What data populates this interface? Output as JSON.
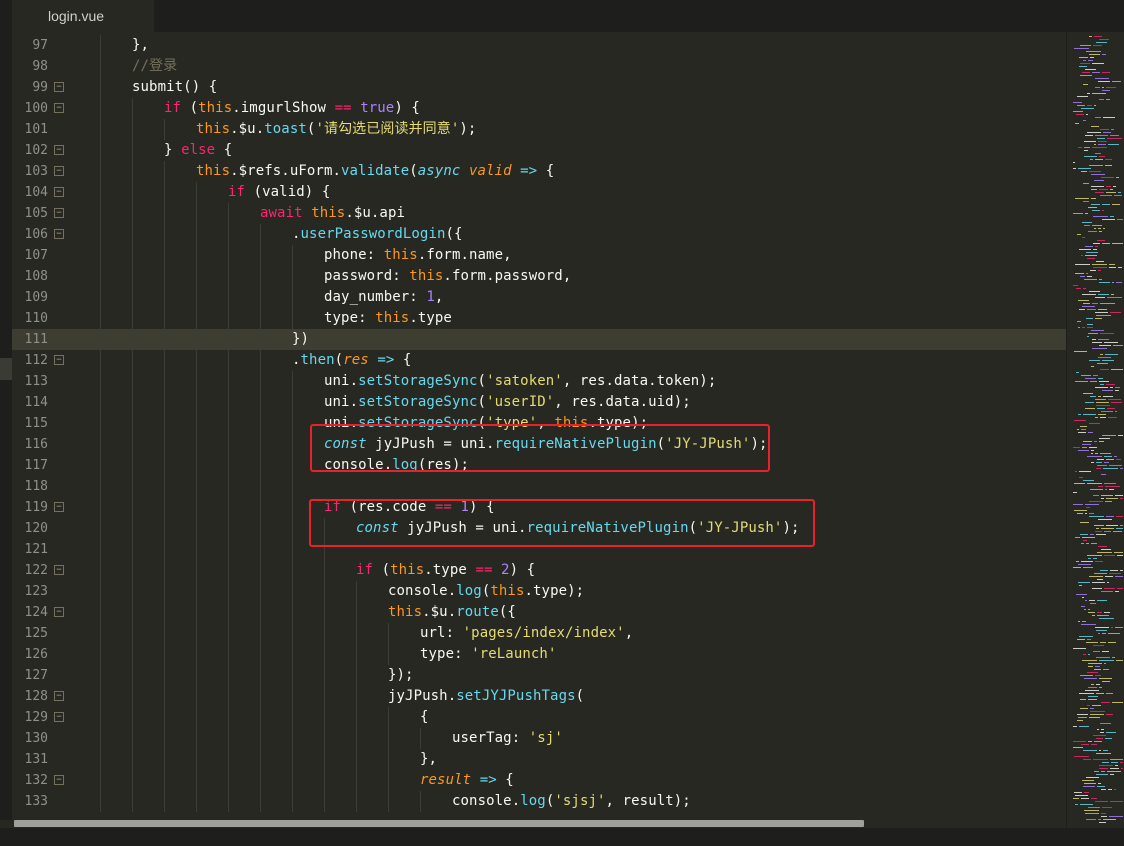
{
  "tab": {
    "filename": "login.vue"
  },
  "colors": {
    "background": "#272822",
    "keyword": "#f92672",
    "this": "#fd971f",
    "function": "#66d9ef",
    "string": "#e6db74",
    "number": "#ae81ff",
    "comment": "#75715e",
    "highlight_box": "#e8212b"
  },
  "current_line": "111",
  "lines": [
    {
      "ln": "97",
      "indent": 2,
      "fold": false,
      "tokens": [
        [
          "},",
          ""
        ]
      ]
    },
    {
      "ln": "98",
      "indent": 2,
      "fold": false,
      "tokens": [
        [
          "//登录",
          "c"
        ]
      ]
    },
    {
      "ln": "99",
      "indent": 2,
      "fold": true,
      "tokens": [
        [
          "submit() {",
          ""
        ]
      ]
    },
    {
      "ln": "100",
      "indent": 3,
      "fold": true,
      "tokens": [
        [
          "if",
          "k"
        ],
        [
          " (",
          ""
        ],
        [
          "this",
          "t"
        ],
        [
          ".imgurlShow ",
          ""
        ],
        [
          "==",
          "k"
        ],
        [
          " ",
          ""
        ],
        [
          "true",
          "n"
        ],
        [
          ") {",
          ""
        ]
      ]
    },
    {
      "ln": "101",
      "indent": 4,
      "fold": false,
      "tokens": [
        [
          "this",
          "t"
        ],
        [
          ".$u.",
          ""
        ],
        [
          "toast",
          "f"
        ],
        [
          "(",
          ""
        ],
        [
          "'请勾选已阅读并同意'",
          "s"
        ],
        [
          ");",
          ""
        ]
      ]
    },
    {
      "ln": "102",
      "indent": 3,
      "fold": true,
      "tokens": [
        [
          "} ",
          ""
        ],
        [
          "else",
          "k"
        ],
        [
          " {",
          ""
        ]
      ]
    },
    {
      "ln": "103",
      "indent": 4,
      "fold": true,
      "tokens": [
        [
          "this",
          "t"
        ],
        [
          ".$refs.uForm.",
          ""
        ],
        [
          "validate",
          "f"
        ],
        [
          "(",
          ""
        ],
        [
          "async",
          "fi"
        ],
        [
          " ",
          ""
        ],
        [
          "valid",
          "p"
        ],
        [
          " ",
          ""
        ],
        [
          "=>",
          "f"
        ],
        [
          " {",
          ""
        ]
      ]
    },
    {
      "ln": "104",
      "indent": 5,
      "fold": true,
      "tokens": [
        [
          "if",
          "k"
        ],
        [
          " (valid) {",
          ""
        ]
      ]
    },
    {
      "ln": "105",
      "indent": 6,
      "fold": true,
      "tokens": [
        [
          "await",
          "k"
        ],
        [
          " ",
          ""
        ],
        [
          "this",
          "t"
        ],
        [
          ".$u.api",
          ""
        ]
      ]
    },
    {
      "ln": "106",
      "indent": 7,
      "fold": true,
      "tokens": [
        [
          ".",
          ""
        ],
        [
          "userPasswordLogin",
          "f"
        ],
        [
          "({",
          ""
        ]
      ]
    },
    {
      "ln": "107",
      "indent": 8,
      "fold": false,
      "tokens": [
        [
          "phone: ",
          ""
        ],
        [
          "this",
          "t"
        ],
        [
          ".form.name,",
          ""
        ]
      ]
    },
    {
      "ln": "108",
      "indent": 8,
      "fold": false,
      "tokens": [
        [
          "password: ",
          ""
        ],
        [
          "this",
          "t"
        ],
        [
          ".form.password,",
          ""
        ]
      ]
    },
    {
      "ln": "109",
      "indent": 8,
      "fold": false,
      "tokens": [
        [
          "day_number: ",
          ""
        ],
        [
          "1",
          "n"
        ],
        [
          ",",
          ""
        ]
      ]
    },
    {
      "ln": "110",
      "indent": 8,
      "fold": false,
      "tokens": [
        [
          "type: ",
          ""
        ],
        [
          "this",
          "t"
        ],
        [
          ".type",
          ""
        ]
      ]
    },
    {
      "ln": "111",
      "indent": 7,
      "fold": false,
      "tokens": [
        [
          "})",
          ""
        ]
      ]
    },
    {
      "ln": "112",
      "indent": 7,
      "fold": true,
      "tokens": [
        [
          ".",
          ""
        ],
        [
          "then",
          "f"
        ],
        [
          "(",
          ""
        ],
        [
          "res",
          "p"
        ],
        [
          " ",
          ""
        ],
        [
          "=>",
          "f"
        ],
        [
          " {",
          ""
        ]
      ]
    },
    {
      "ln": "113",
      "indent": 8,
      "fold": false,
      "tokens": [
        [
          "uni.",
          ""
        ],
        [
          "setStorageSync",
          "f"
        ],
        [
          "(",
          ""
        ],
        [
          "'satoken'",
          "s"
        ],
        [
          ", res.data.token);",
          ""
        ]
      ]
    },
    {
      "ln": "114",
      "indent": 8,
      "fold": false,
      "tokens": [
        [
          "uni.",
          ""
        ],
        [
          "setStorageSync",
          "f"
        ],
        [
          "(",
          ""
        ],
        [
          "'userID'",
          "s"
        ],
        [
          ", res.data.uid);",
          ""
        ]
      ]
    },
    {
      "ln": "115",
      "indent": 8,
      "fold": false,
      "tokens": [
        [
          "uni.",
          ""
        ],
        [
          "setStorageSync",
          "f"
        ],
        [
          "(",
          ""
        ],
        [
          "'type'",
          "s"
        ],
        [
          ", ",
          ""
        ],
        [
          "this",
          "t"
        ],
        [
          ".type);",
          ""
        ]
      ]
    },
    {
      "ln": "116",
      "indent": 8,
      "fold": false,
      "tokens": [
        [
          "const",
          "fi"
        ],
        [
          " jyJPush = uni.",
          ""
        ],
        [
          "requireNativePlugin",
          "f"
        ],
        [
          "(",
          ""
        ],
        [
          "'JY-JPush'",
          "s"
        ],
        [
          ");",
          ""
        ]
      ]
    },
    {
      "ln": "117",
      "indent": 8,
      "fold": false,
      "tokens": [
        [
          "console.",
          ""
        ],
        [
          "log",
          "f"
        ],
        [
          "(res);",
          ""
        ]
      ]
    },
    {
      "ln": "118",
      "indent": 8,
      "fold": false,
      "tokens": []
    },
    {
      "ln": "119",
      "indent": 8,
      "fold": true,
      "tokens": [
        [
          "if",
          "k"
        ],
        [
          " (res.code ",
          ""
        ],
        [
          "==",
          "k"
        ],
        [
          " ",
          ""
        ],
        [
          "1",
          "n"
        ],
        [
          ") {",
          ""
        ]
      ]
    },
    {
      "ln": "120",
      "indent": 9,
      "fold": false,
      "tokens": [
        [
          "const",
          "fi"
        ],
        [
          " jyJPush = uni.",
          ""
        ],
        [
          "requireNativePlugin",
          "f"
        ],
        [
          "(",
          ""
        ],
        [
          "'JY-JPush'",
          "s"
        ],
        [
          ");",
          ""
        ]
      ]
    },
    {
      "ln": "121",
      "indent": 9,
      "fold": false,
      "tokens": []
    },
    {
      "ln": "122",
      "indent": 9,
      "fold": true,
      "tokens": [
        [
          "if",
          "k"
        ],
        [
          " (",
          ""
        ],
        [
          "this",
          "t"
        ],
        [
          ".type ",
          ""
        ],
        [
          "==",
          "k"
        ],
        [
          " ",
          ""
        ],
        [
          "2",
          "n"
        ],
        [
          ") {",
          ""
        ]
      ]
    },
    {
      "ln": "123",
      "indent": 10,
      "fold": false,
      "tokens": [
        [
          "console.",
          ""
        ],
        [
          "log",
          "f"
        ],
        [
          "(",
          ""
        ],
        [
          "this",
          "t"
        ],
        [
          ".type);",
          ""
        ]
      ]
    },
    {
      "ln": "124",
      "indent": 10,
      "fold": true,
      "tokens": [
        [
          "this",
          "t"
        ],
        [
          ".$u.",
          ""
        ],
        [
          "route",
          "f"
        ],
        [
          "({",
          ""
        ]
      ]
    },
    {
      "ln": "125",
      "indent": 11,
      "fold": false,
      "tokens": [
        [
          "url: ",
          ""
        ],
        [
          "'pages/index/index'",
          "s"
        ],
        [
          ",",
          ""
        ]
      ]
    },
    {
      "ln": "126",
      "indent": 11,
      "fold": false,
      "tokens": [
        [
          "type: ",
          ""
        ],
        [
          "'reLaunch'",
          "s"
        ]
      ]
    },
    {
      "ln": "127",
      "indent": 10,
      "fold": false,
      "tokens": [
        [
          "});",
          ""
        ]
      ]
    },
    {
      "ln": "128",
      "indent": 10,
      "fold": true,
      "tokens": [
        [
          "jyJPush.",
          ""
        ],
        [
          "setJYJPushTags",
          "f"
        ],
        [
          "(",
          ""
        ]
      ]
    },
    {
      "ln": "129",
      "indent": 11,
      "fold": true,
      "tokens": [
        [
          "{",
          ""
        ]
      ]
    },
    {
      "ln": "130",
      "indent": 12,
      "fold": false,
      "tokens": [
        [
          "userTag: ",
          ""
        ],
        [
          "'sj'",
          "s"
        ]
      ]
    },
    {
      "ln": "131",
      "indent": 11,
      "fold": false,
      "tokens": [
        [
          "},",
          ""
        ]
      ]
    },
    {
      "ln": "132",
      "indent": 11,
      "fold": true,
      "tokens": [
        [
          "result",
          "p"
        ],
        [
          " ",
          ""
        ],
        [
          "=>",
          "f"
        ],
        [
          " {",
          ""
        ]
      ]
    },
    {
      "ln": "133",
      "indent": 12,
      "fold": false,
      "tokens": [
        [
          "console.",
          ""
        ],
        [
          "log",
          "f"
        ],
        [
          "(",
          ""
        ],
        [
          "'sjsj'",
          "s"
        ],
        [
          ", result);",
          ""
        ]
      ]
    }
  ]
}
